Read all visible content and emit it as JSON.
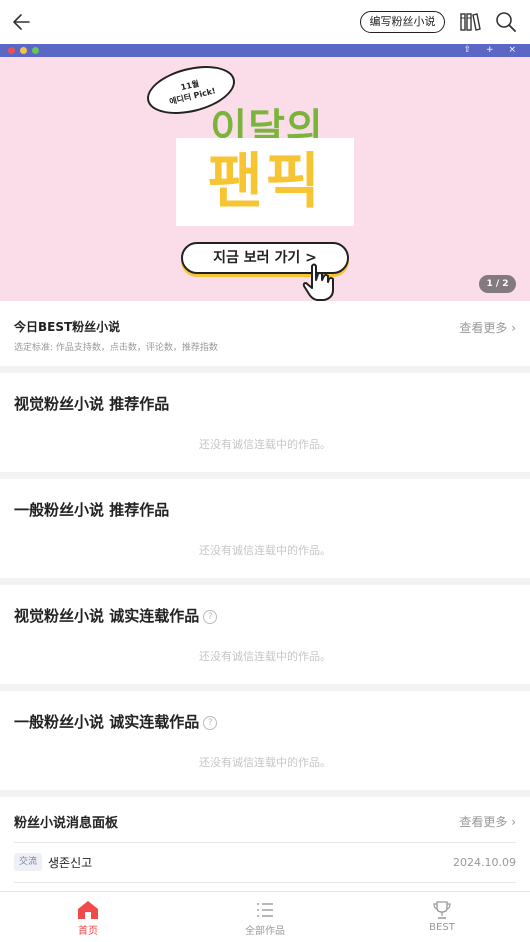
{
  "header": {
    "write_label": "编写粉丝小说"
  },
  "banner": {
    "bubble_text": "11월\n에디터 Pick!",
    "headline_1": "이달의",
    "headline_2": "팬픽",
    "cta_label": "지금 보러 가기 >",
    "page_indicator": "1 / 2",
    "bar_icons": "⇧ + ×"
  },
  "best_today": {
    "title": "今日BEST粉丝小说",
    "criteria": "选定标准: 作品支持数，点击数，评论数，推荐指数",
    "more_label": "查看更多"
  },
  "sections": [
    {
      "title": "视觉粉丝小说 推荐作品",
      "empty": "还没有诚信连载中的作品。",
      "has_help": false
    },
    {
      "title": "一般粉丝小说 推荐作品",
      "empty": "还没有诚信连载中的作品。",
      "has_help": false
    },
    {
      "title": "视觉粉丝小说 诚实连载作品",
      "empty": "还没有诚信连载中的作品。",
      "has_help": true
    },
    {
      "title": "一般粉丝小说 诚实连载作品",
      "empty": "还没有诚信连载中的作品。",
      "has_help": true
    }
  ],
  "board": {
    "title": "粉丝小说消息面板",
    "more_label": "查看更多",
    "posts": [
      {
        "tag": "交流",
        "title": "생존신고",
        "date": "2024.10.09"
      }
    ]
  },
  "bottom_nav": {
    "items": [
      {
        "label": "首页",
        "icon": "home-icon",
        "active": true
      },
      {
        "label": "全部作品",
        "icon": "list-icon",
        "active": false
      },
      {
        "label": "BEST",
        "icon": "trophy-icon",
        "active": false
      }
    ]
  },
  "colors": {
    "accent": "#f04a4a",
    "banner_bg": "#fbdce9",
    "banner_bar": "#5a67c4",
    "headline_green": "#7ab43a",
    "headline_yellow": "#f7c534"
  }
}
